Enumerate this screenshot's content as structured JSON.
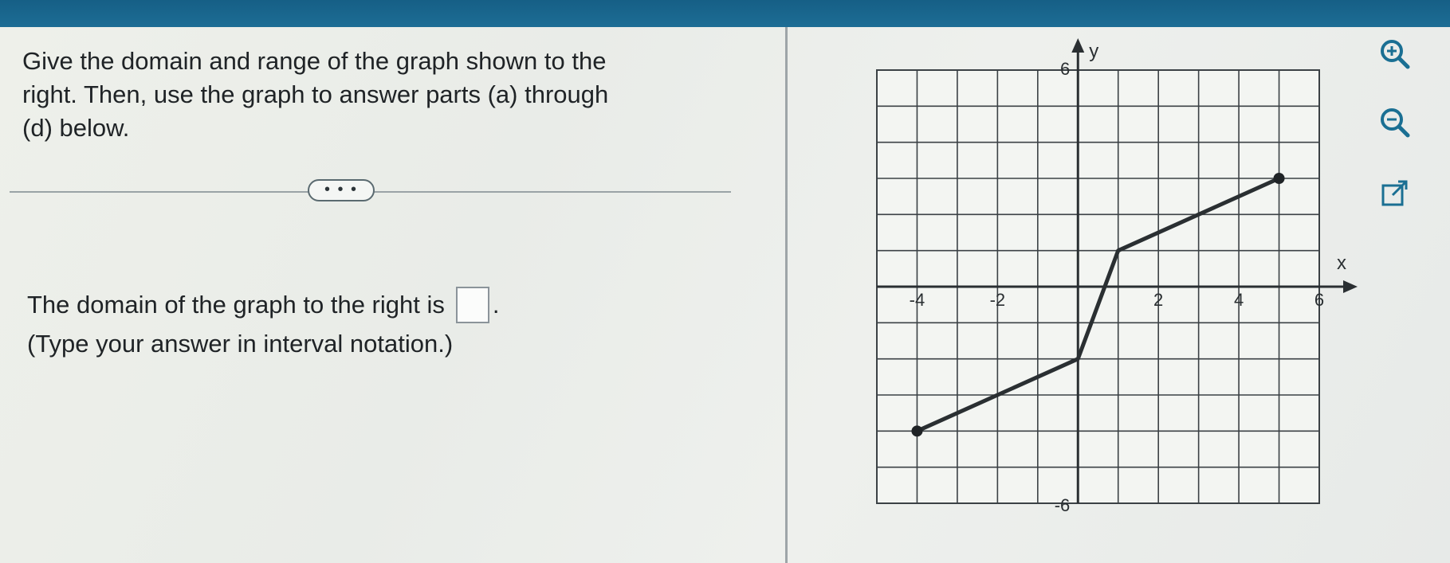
{
  "question": {
    "line1": "Give the domain and range of the graph shown to the",
    "line2": "right. Then, use the graph to answer parts (a) through",
    "line3": "(d) below."
  },
  "more_button": {
    "label": "• • •"
  },
  "prompt": {
    "domain_text": "The domain of the graph to the right is",
    "domain_value": "",
    "period": ".",
    "hint": "(Type your answer in interval notation.)"
  },
  "graph": {
    "x_axis_label": "x",
    "y_axis_label": "y",
    "x_tick_labels": [
      "-4",
      "-2",
      "2",
      "4",
      "6"
    ],
    "y_tick_labels": [
      "6",
      "-6"
    ]
  },
  "chart_data": {
    "type": "line",
    "x": [
      -4,
      0,
      1,
      5
    ],
    "y": [
      -4,
      -2,
      1,
      3
    ],
    "xlim": [
      -5,
      6
    ],
    "ylim": [
      -6,
      6
    ],
    "grid": true,
    "xlabel": "x",
    "ylabel": "y",
    "endpoints": "closed"
  },
  "tools": {
    "zoom_in": "zoom-in-icon",
    "zoom_out": "zoom-out-icon",
    "popout": "external-link-icon",
    "accent_color": "#1a6f93"
  }
}
